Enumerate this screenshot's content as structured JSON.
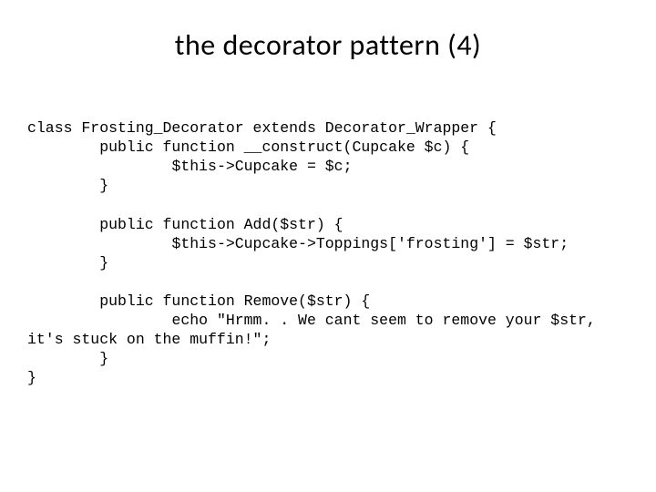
{
  "slide": {
    "title": "the decorator pattern (4)",
    "code": "class Frosting_Decorator extends Decorator_Wrapper {\n        public function __construct(Cupcake $c) {\n                $this->Cupcake = $c;\n        }\n\n        public function Add($str) {\n                $this->Cupcake->Toppings['frosting'] = $str;\n        }\n\n        public function Remove($str) {\n                echo \"Hrmm. . We cant seem to remove your $str, it's stuck on the muffin!\";\n        }\n}"
  }
}
